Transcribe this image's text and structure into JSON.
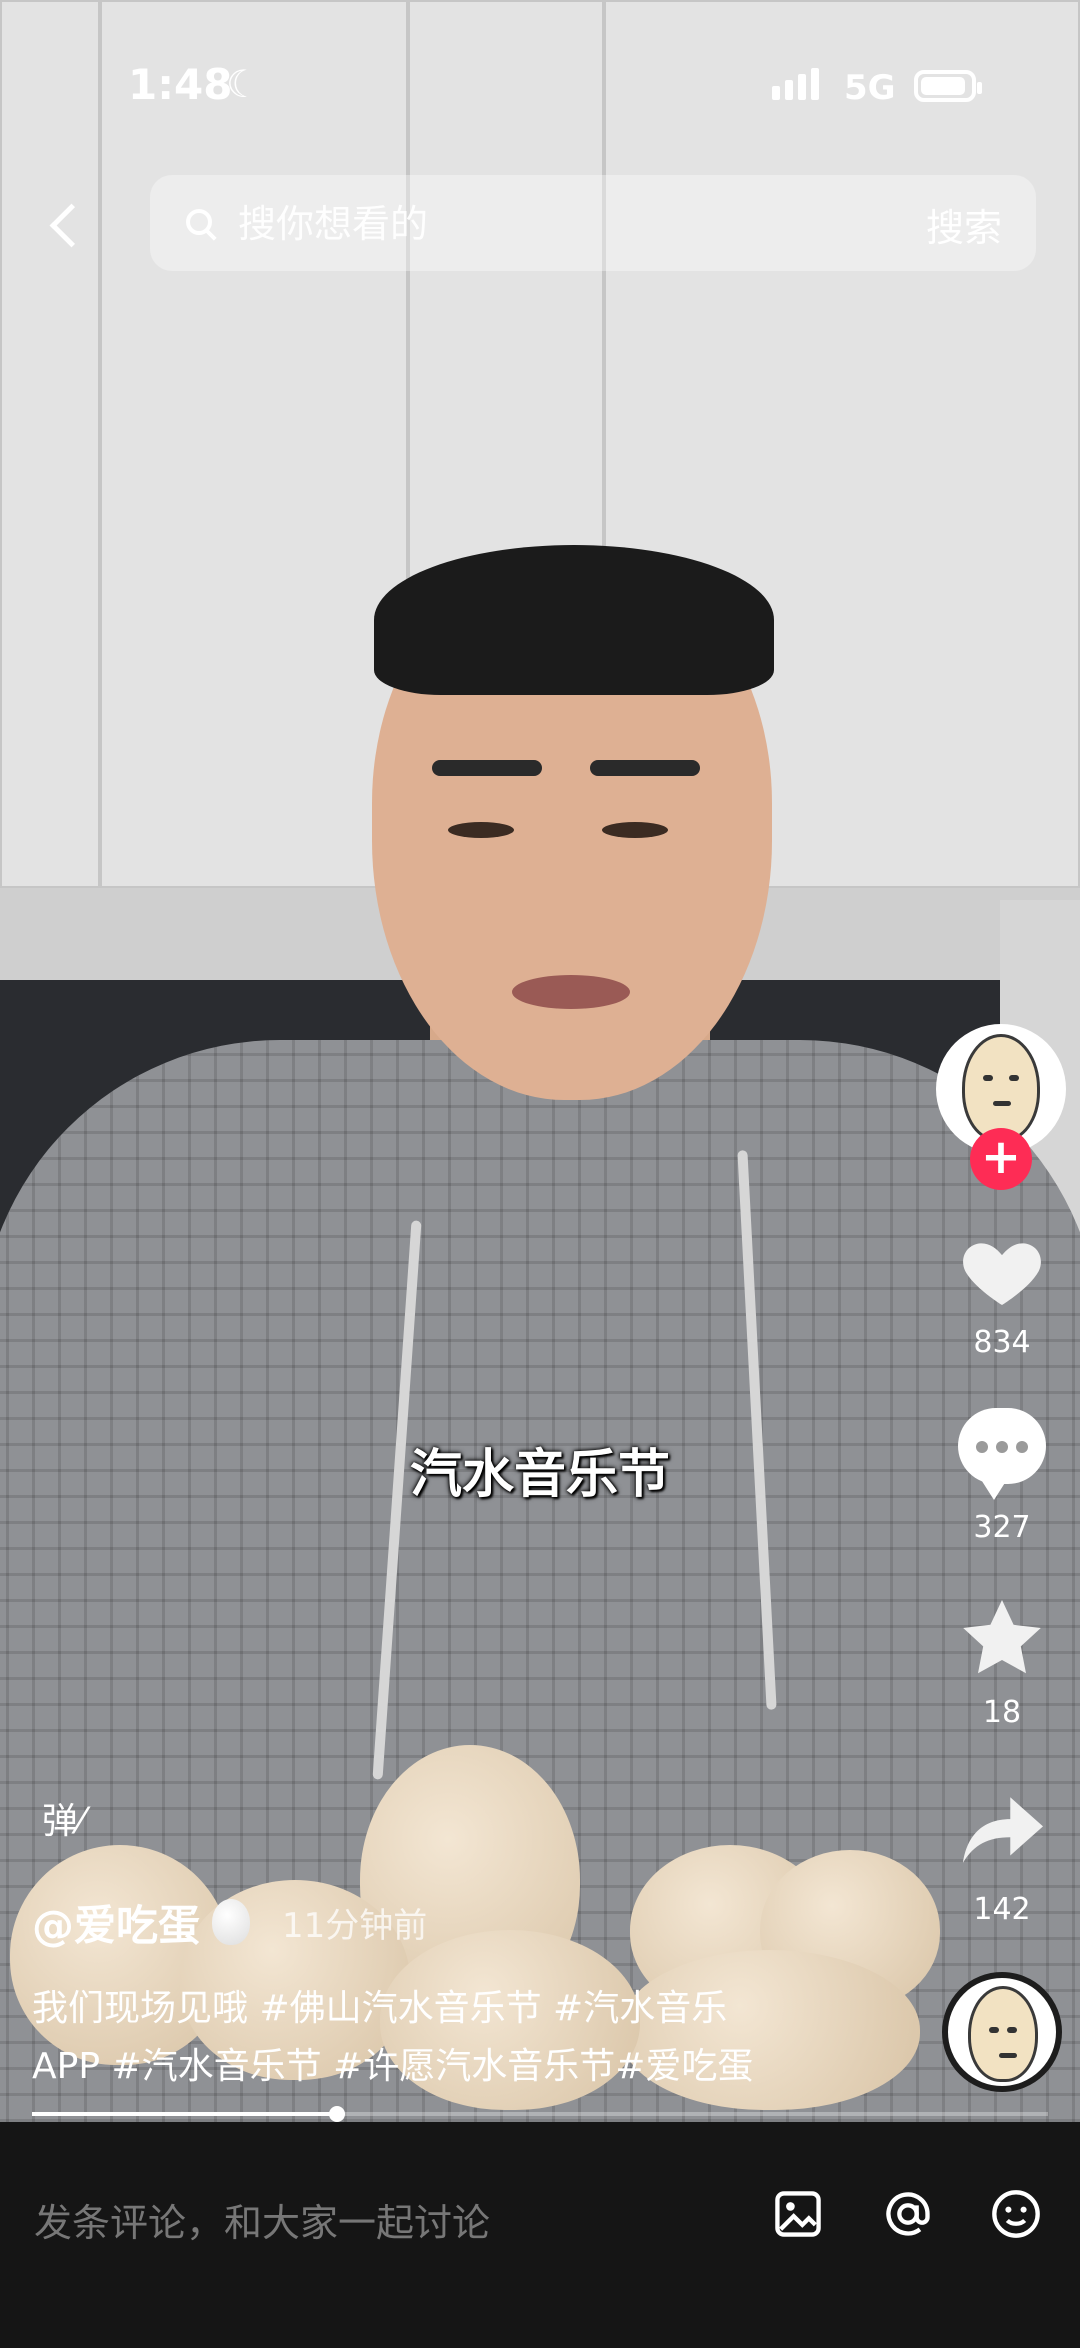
{
  "status_bar": {
    "time": "1:48",
    "network": "5G"
  },
  "search": {
    "placeholder": "搜你想看的",
    "button_label": "搜索"
  },
  "video": {
    "subtitle": "汽水音乐节"
  },
  "actions": {
    "likes": "834",
    "comments": "327",
    "favorites": "18",
    "shares": "142",
    "follow_icon": "plus-icon"
  },
  "post": {
    "author": "@爱吃蛋",
    "posted_ago": "11分钟前",
    "caption_line1": "我们现场见哦 #佛山汽水音乐节 #汽水音乐",
    "caption_line2": "APP #汽水音乐节 #许愿汽水音乐节#爱吃蛋",
    "danmu_label": "弹"
  },
  "playback": {
    "progress": 0.3
  },
  "comment_bar": {
    "placeholder": "发条评论，和大家一起讨论"
  },
  "colors": {
    "accent": "#fe2c55",
    "bar_bg": "#151515"
  }
}
